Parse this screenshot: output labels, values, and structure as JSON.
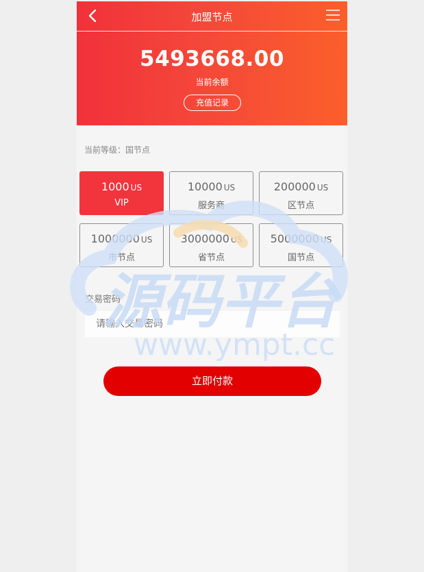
{
  "header": {
    "title": "加盟节点",
    "back_icon": "chevron-left-icon",
    "menu_icon": "hamburger-menu-icon"
  },
  "balance": {
    "amount": "5493668.00",
    "label": "当前余额",
    "recharge_button": "充值记录"
  },
  "current_level": "当前等级：国节点",
  "tiers": [
    {
      "amount": "1000",
      "unit": "US",
      "name": "VIP",
      "selected": true
    },
    {
      "amount": "10000",
      "unit": "US",
      "name": "服务商",
      "selected": false
    },
    {
      "amount": "200000",
      "unit": "US",
      "name": "区节点",
      "selected": false
    },
    {
      "amount": "1000000",
      "unit": "US",
      "name": "市节点",
      "selected": false
    },
    {
      "amount": "3000000",
      "unit": "US",
      "name": "省节点",
      "selected": false
    },
    {
      "amount": "5000000",
      "unit": "US",
      "name": "国节点",
      "selected": false
    }
  ],
  "password": {
    "label": "交易密码",
    "placeholder": "请输入交易密码",
    "value": ""
  },
  "pay_button": "立即付款",
  "watermark": {
    "title": "源码平台",
    "url": "www.ympt.cc"
  },
  "colors": {
    "header_gradient_start": "#f1313a",
    "header_gradient_end": "#fb5f2a",
    "active_tier": "#f2343d",
    "pay_button": "#e20000",
    "page_bg": "#f5f5f5",
    "outer_bg": "#efefef"
  }
}
